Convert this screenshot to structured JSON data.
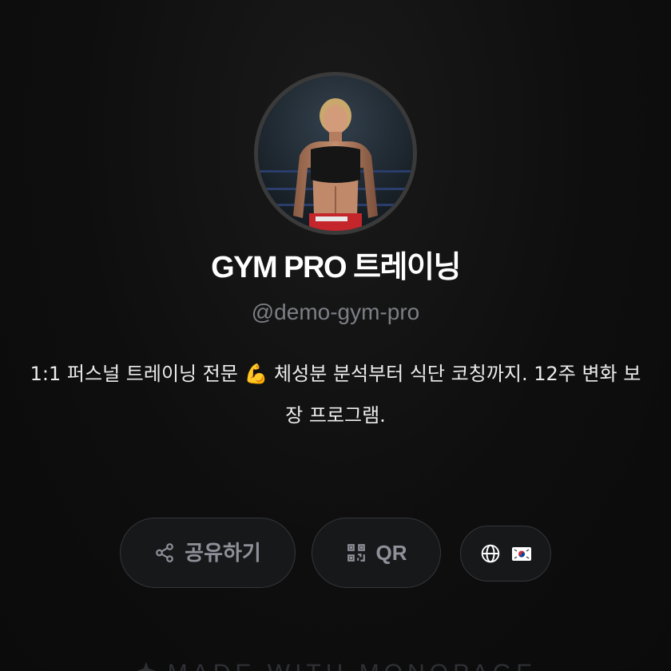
{
  "profile": {
    "name": "GYM PRO 트레이닝",
    "handle": "@demo-gym-pro",
    "bio": "1:1 퍼스널 트레이닝 전문 💪  체성분 분석부터 식단 코칭까지. 12주 변화 보장 프로그램.",
    "avatar_alt": "fitness-trainer-photo"
  },
  "actions": {
    "share_label": "공유하기",
    "qr_label": "QR",
    "language_flag": "korean-flag"
  },
  "footer": {
    "text": "MADE WITH MONOPAGE"
  },
  "colors": {
    "background": "#0e0e0e",
    "button_bg": "#17181a",
    "button_border": "#34363b",
    "muted_text": "#8e9199",
    "handle_text": "#7d7f86"
  }
}
